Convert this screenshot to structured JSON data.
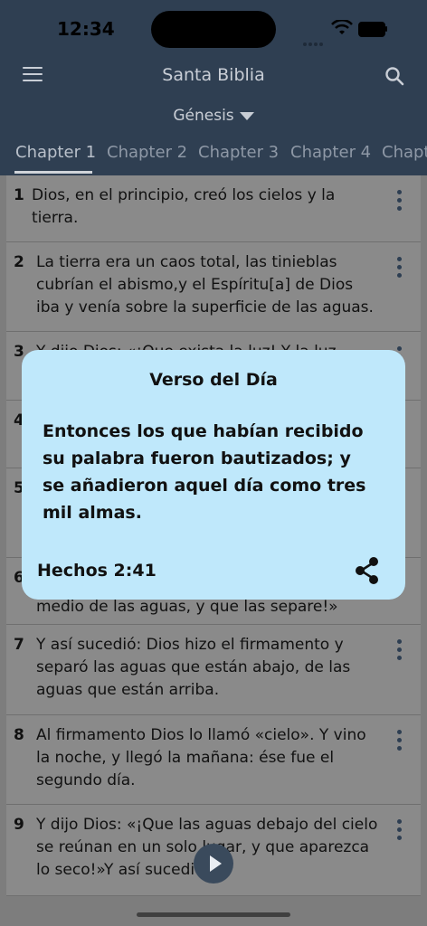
{
  "status_bar": {
    "time": "12:34"
  },
  "header": {
    "title": "Santa Biblia",
    "book": "Génesis"
  },
  "tabs": [
    {
      "label": "Chapter 1"
    },
    {
      "label": "Chapter 2"
    },
    {
      "label": "Chapter 3"
    },
    {
      "label": "Chapter 4"
    },
    {
      "label": "Chapt"
    }
  ],
  "verses": [
    {
      "num": "1",
      "text": "Dios, en el principio,    creó los cielos y la tierra."
    },
    {
      "num": "2",
      "text": "La tierra era un caos total,    las tinieblas cubrían el abismo,y el Espíritu[a] de Dios iba y venía    sobre la superficie de las aguas."
    },
    {
      "num": "3",
      "text": "Y dijo Dios: «¡Que exista la luz!    Y la luz"
    },
    {
      "num": "4",
      "text": ""
    },
    {
      "num": "5",
      "text": ""
    },
    {
      "num": "6",
      "text": "medio de las aguas, y que las separe!»"
    },
    {
      "num": "7",
      "text": "Y así sucedió: Dios hizo el firmamento    y separó las aguas que están abajo,    de las aguas que están arriba."
    },
    {
      "num": "8",
      "text": "Al firmamento Dios lo llamó «cielo».    Y vino la noche, y llegó la mañana:    ése fue el segundo día."
    },
    {
      "num": "9",
      "text": "Y dijo Dios: «¡Que las aguas debajo del cielo    se reúnan en un solo lugar,    y que aparezca lo seco!»Y así sucedió."
    }
  ],
  "popup": {
    "title": "Verso del Día",
    "text": "Entonces los que habían recibido su palabra fueron bautizados; y se añadieron aquel día como tres mil almas.",
    "reference": "Hechos 2:41"
  },
  "colors": {
    "header_bg": "#2f3f52",
    "popup_bg": "#bfe8fb",
    "overlay_list_bg": "#8a8a8a"
  }
}
